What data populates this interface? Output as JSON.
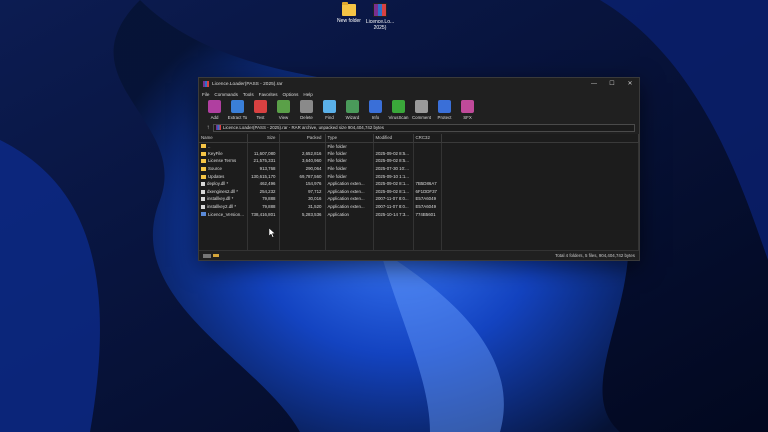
{
  "desktop": {
    "icons": [
      {
        "label": "New folder",
        "type": "folder"
      },
      {
        "label_line1": "Licence.Lo...",
        "label_line2": "2025)",
        "type": "rar"
      }
    ]
  },
  "window": {
    "title": "Licence.Loader(PASS - 2025).rar",
    "controls": {
      "minimize": "—",
      "maximize": "☐",
      "close": "✕"
    }
  },
  "menu": [
    "File",
    "Commands",
    "Tools",
    "Favorites",
    "Options",
    "Help"
  ],
  "toolbar": [
    {
      "label": "Add",
      "icon": "add-icon",
      "color": "#b03fa0"
    },
    {
      "label": "Extract To",
      "icon": "extract-icon",
      "color": "#3a7fd8"
    },
    {
      "label": "Test",
      "icon": "test-icon",
      "color": "#d94141"
    },
    {
      "label": "View",
      "icon": "view-icon",
      "color": "#5aa048"
    },
    {
      "label": "Delete",
      "icon": "delete-icon",
      "color": "#8a8a8a"
    },
    {
      "label": "Find",
      "icon": "find-icon",
      "color": "#5ab0e8"
    },
    {
      "label": "Wizard",
      "icon": "wizard-icon",
      "color": "#4a9a5a"
    },
    {
      "label": "Info",
      "icon": "info-icon",
      "color": "#3a6fd8"
    },
    {
      "label": "VirusScan",
      "icon": "virusscan-icon",
      "color": "#3aa83a"
    },
    {
      "label": "Comment",
      "icon": "comment-icon",
      "color": "#9a9a9a"
    },
    {
      "label": "Protect",
      "icon": "protect-icon",
      "color": "#3a6fd8"
    },
    {
      "label": "SFX",
      "icon": "sfx-icon",
      "color": "#c04a9a"
    }
  ],
  "address": {
    "path": "Licence.Loader(PASS - 2025).rar - RAR archive, unpacked size 904,404,742 bytes",
    "up": "↑"
  },
  "columns": [
    "Name",
    "Size",
    "Packed",
    "Type",
    "Modified",
    "CRC32"
  ],
  "files": [
    {
      "name": "..",
      "size": "",
      "packed": "",
      "type": "File folder",
      "modified": "",
      "crc": "",
      "kind": "folder"
    },
    {
      "name": "KeyFile",
      "size": "11,607,080",
      "packed": "2,652,816",
      "type": "File folder",
      "modified": "2025-09-02 8:5...",
      "crc": "",
      "kind": "folder"
    },
    {
      "name": "License Terms",
      "size": "21,575,331",
      "packed": "3,640,960",
      "type": "File folder",
      "modified": "2025-09-02 8:5...",
      "crc": "",
      "kind": "folder"
    },
    {
      "name": "Source",
      "size": "913,768",
      "packed": "290,064",
      "type": "File folder",
      "modified": "2025-07-30 10:...",
      "crc": "",
      "kind": "folder"
    },
    {
      "name": "Updates",
      "size": "130,615,170",
      "packed": "69,787,560",
      "type": "File folder",
      "modified": "2025-09-10 1:1...",
      "crc": "",
      "kind": "folder"
    },
    {
      "name": "deploy.dll *",
      "size": "462,496",
      "packed": "154,976",
      "type": "Application exten...",
      "modified": "2025-09-02 8:1...",
      "crc": "7B5D86A7",
      "kind": "file"
    },
    {
      "name": "dxengines2.dll *",
      "size": "254,232",
      "packed": "97,712",
      "type": "Application exten...",
      "modified": "2025-09-02 8:1...",
      "crc": "6F1DDF37",
      "kind": "file"
    },
    {
      "name": "installkey.dll *",
      "size": "79,888",
      "packed": "30,016",
      "type": "Application exten...",
      "modified": "2007-11-07 8:0...",
      "crc": "E57A6049",
      "kind": "file"
    },
    {
      "name": "installkey2.dll *",
      "size": "79,888",
      "packed": "31,520",
      "type": "Application exten...",
      "modified": "2007-11-07 8:0...",
      "crc": "E57A6049",
      "kind": "file"
    },
    {
      "name": "Licence_Version...",
      "size": "738,416,801",
      "packed": "5,283,536",
      "type": "Application",
      "modified": "2025-10-14 7:3...",
      "crc": "774B5601",
      "kind": "app"
    }
  ],
  "status": {
    "total": "Total 4 folders, 5 files, 904,404,742 bytes"
  },
  "colors": {
    "window_bg": "#202020",
    "list_bg": "#1c1c1c",
    "folder": "#f5c445"
  }
}
